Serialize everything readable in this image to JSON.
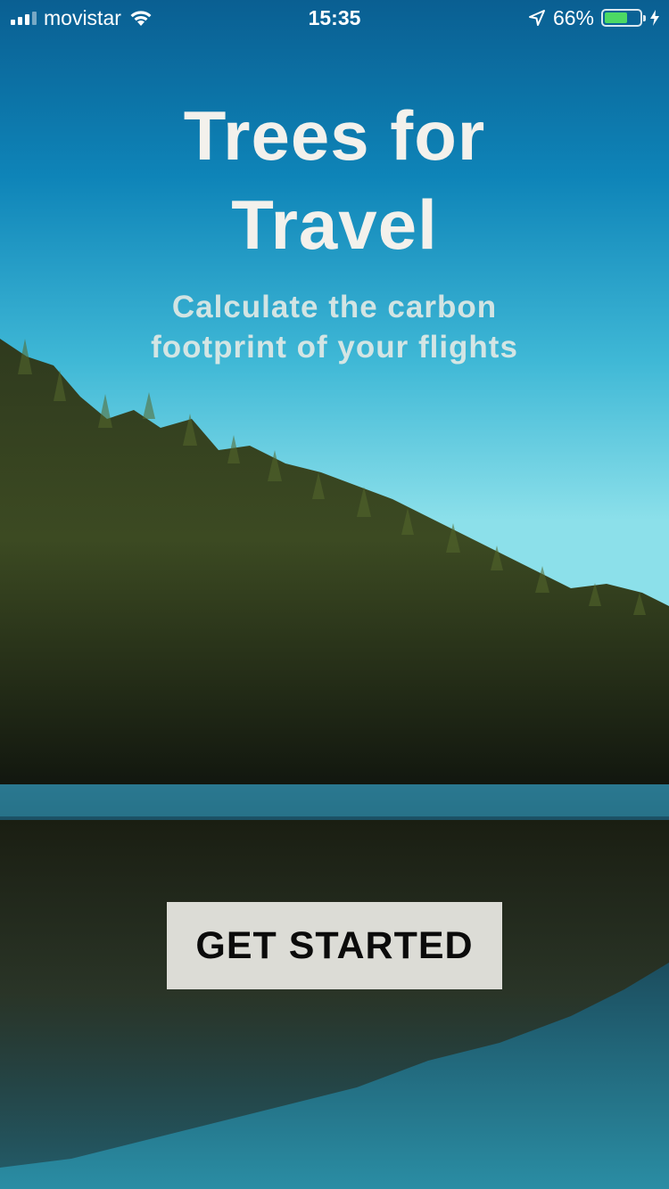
{
  "status_bar": {
    "carrier": "movistar",
    "time": "15:35",
    "battery_percent": "66%",
    "battery_level": 0.66,
    "battery_color": "#4cd964",
    "icons": [
      "signal-icon",
      "wifi-icon",
      "location-arrow-icon",
      "battery-icon",
      "charging-bolt-icon"
    ]
  },
  "hero": {
    "title_line1": "Trees for",
    "title_line2": "Travel",
    "subtitle_line1": "Calculate the carbon",
    "subtitle_line2": "footprint of your flights"
  },
  "cta": {
    "label": "GET STARTED",
    "background": "#dcdcd6"
  },
  "background": {
    "scene": "forest-lake-photo",
    "sky_top": "#0b6f9e",
    "sky_bottom": "#6fd7e6",
    "water": "#1f7f98"
  }
}
